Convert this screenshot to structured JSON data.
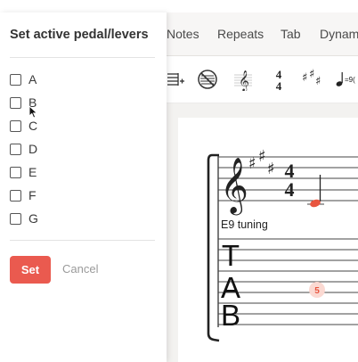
{
  "panel": {
    "title": "Set active pedal/levers",
    "levers": [
      {
        "label": "A",
        "checked": false
      },
      {
        "label": "B",
        "checked": false
      },
      {
        "label": "C",
        "checked": false
      },
      {
        "label": "D",
        "checked": false
      },
      {
        "label": "E",
        "checked": false
      },
      {
        "label": "F",
        "checked": false
      },
      {
        "label": "G",
        "checked": false
      }
    ],
    "set_label": "Set",
    "cancel_label": "Cancel"
  },
  "tabs": [
    "Notes",
    "Repeats",
    "Tab",
    "Dynam"
  ],
  "toolbar": {
    "icons": [
      "line-add-icon",
      "no-staff-icon",
      "treble-clef-icon",
      "time-signature-icon",
      "key-signature-icon",
      "tempo-icon"
    ],
    "time_signature": "4/4",
    "tempo_text": "=9("
  },
  "score": {
    "tuning_label": "E9 tuning",
    "time_signature_top": "4",
    "time_signature_bottom": "4",
    "tab_label": "TAB",
    "tab_fret": "5"
  },
  "colors": {
    "accent": "#ea5a4f",
    "note": "#e8553f"
  }
}
